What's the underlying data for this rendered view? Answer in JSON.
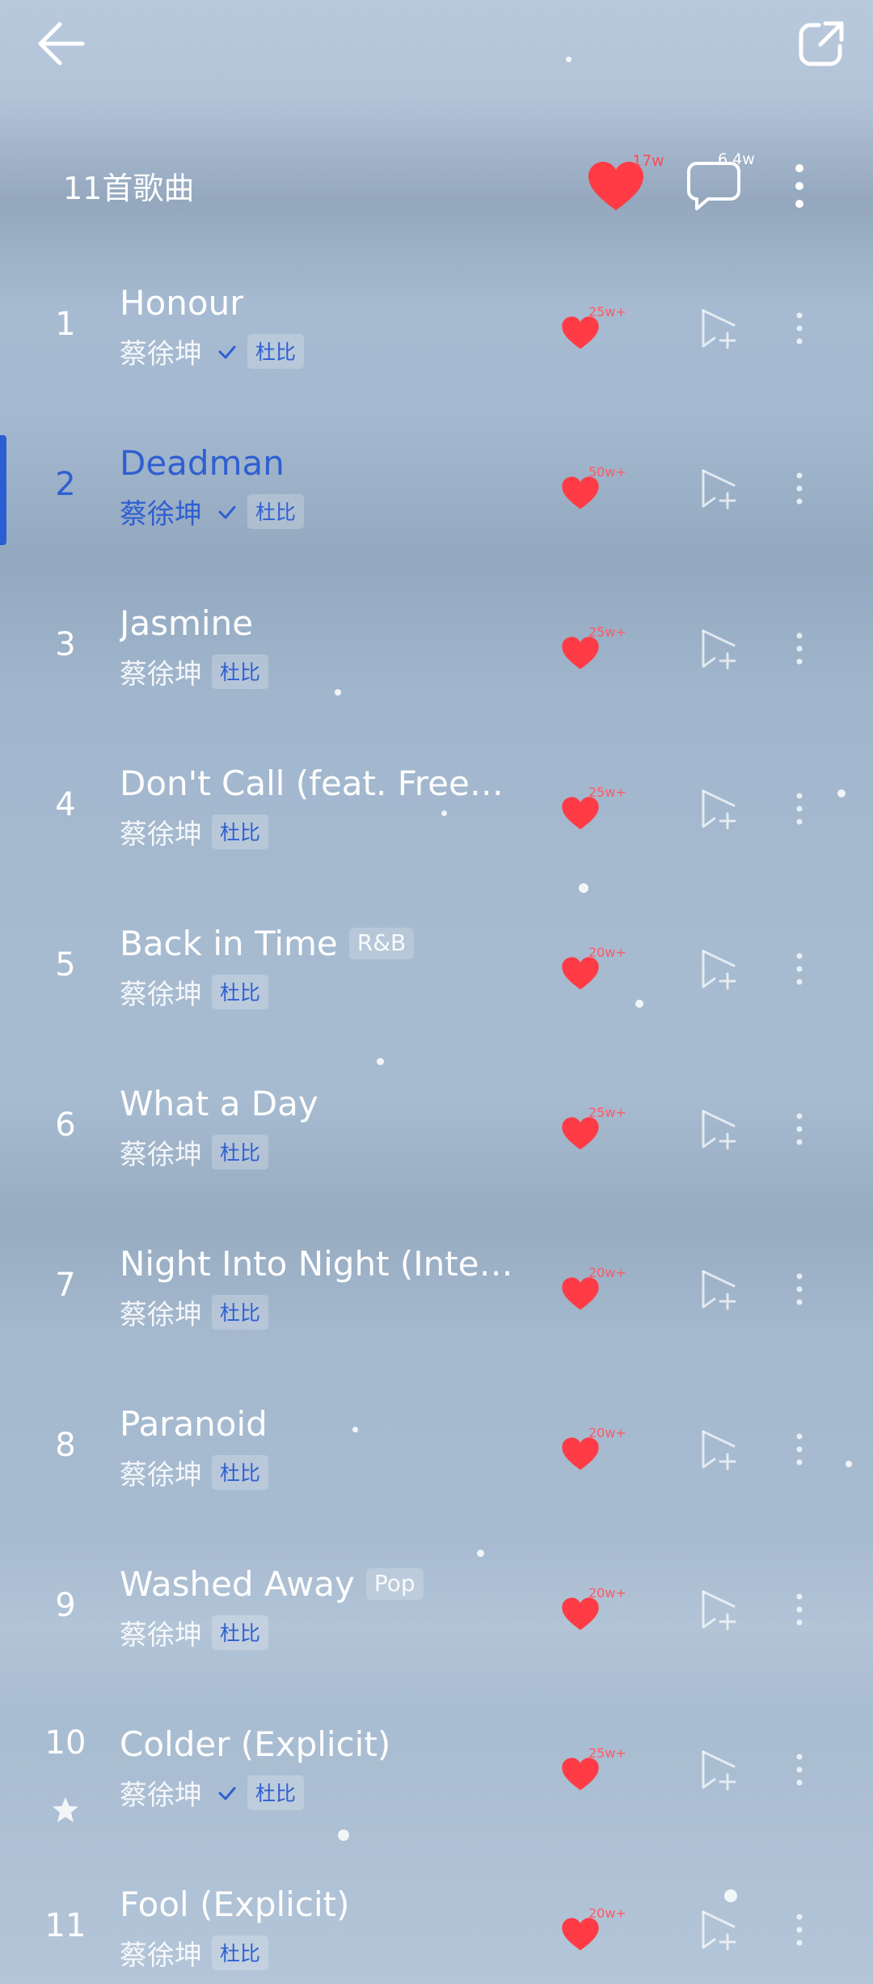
{
  "header": {
    "song_count": "11首歌曲",
    "like_count": "17w",
    "comment_count": "6.4w"
  },
  "colors": {
    "accent": "#2f5fd1",
    "heart": "#ff3b45"
  },
  "tracks": [
    {
      "num": "1",
      "title": "Honour",
      "genre": "",
      "artist": "蔡徐坤",
      "verified": true,
      "badge": "杜比",
      "likes": "25w+",
      "active": false,
      "starred": false
    },
    {
      "num": "2",
      "title": "Deadman",
      "genre": "",
      "artist": "蔡徐坤",
      "verified": true,
      "badge": "杜比",
      "likes": "50w+",
      "active": true,
      "starred": false
    },
    {
      "num": "3",
      "title": "Jasmine",
      "genre": "",
      "artist": "蔡徐坤",
      "verified": false,
      "badge": "杜比",
      "likes": "25w+",
      "active": false,
      "starred": false
    },
    {
      "num": "4",
      "title": "Don't Call (feat. Free…",
      "genre": "",
      "artist": "蔡徐坤",
      "verified": false,
      "badge": "杜比",
      "likes": "25w+",
      "active": false,
      "starred": false
    },
    {
      "num": "5",
      "title": "Back in Time",
      "genre": "R&B",
      "artist": "蔡徐坤",
      "verified": false,
      "badge": "杜比",
      "likes": "20w+",
      "active": false,
      "starred": false
    },
    {
      "num": "6",
      "title": "What a Day",
      "genre": "",
      "artist": "蔡徐坤",
      "verified": false,
      "badge": "杜比",
      "likes": "25w+",
      "active": false,
      "starred": false
    },
    {
      "num": "7",
      "title": "Night Into Night (Inte…",
      "genre": "",
      "artist": "蔡徐坤",
      "verified": false,
      "badge": "杜比",
      "likes": "20w+",
      "active": false,
      "starred": false
    },
    {
      "num": "8",
      "title": "Paranoid",
      "genre": "",
      "artist": "蔡徐坤",
      "verified": false,
      "badge": "杜比",
      "likes": "20w+",
      "active": false,
      "starred": false
    },
    {
      "num": "9",
      "title": "Washed Away",
      "genre": "Pop",
      "artist": "蔡徐坤",
      "verified": false,
      "badge": "杜比",
      "likes": "20w+",
      "active": false,
      "starred": false
    },
    {
      "num": "10",
      "title": "Colder (Explicit)",
      "genre": "",
      "artist": "蔡徐坤",
      "verified": true,
      "badge": "杜比",
      "likes": "25w+",
      "active": false,
      "starred": true
    },
    {
      "num": "11",
      "title": "Fool (Explicit)",
      "genre": "",
      "artist": "蔡徐坤",
      "verified": false,
      "badge": "杜比",
      "likes": "20w+",
      "active": false,
      "starred": false
    }
  ]
}
